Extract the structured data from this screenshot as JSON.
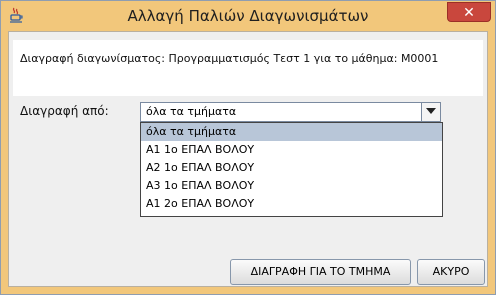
{
  "window": {
    "title": "Αλλαγή Παλιών Διαγωνισμάτων",
    "close_label": "✕"
  },
  "message": "Διαγραφή διαγωνίσματος: Προγραμματισμός Τεστ 1 για το μάθημα: Μ0001",
  "delete_from": {
    "label": "Διαγραφή από:",
    "selected": "όλα τα τμήματα",
    "options": [
      "όλα τα τμήματα",
      "Α1 1ο ΕΠΑΛ ΒΟΛΟΥ",
      "Α2 1ο ΕΠΑΛ ΒΟΛΟΥ",
      "Α3 1ο ΕΠΑΛ ΒΟΛΟΥ",
      "Α1 2ο ΕΠΑΛ ΒΟΛΟΥ"
    ]
  },
  "buttons": {
    "delete_label": "ΔΙΑΓΡΑΦΗ ΓΙΑ ΤΟ ΤΜΗΜΑ",
    "cancel_label": "ΑΚΥΡΟ"
  },
  "icons": {
    "app": "java-cup-icon",
    "close": "close-icon",
    "dropdown": "chevron-down-icon"
  },
  "colors": {
    "titlebar": "#f2c77b",
    "close_button": "#c9473d",
    "selection": "#b8c6d8"
  }
}
